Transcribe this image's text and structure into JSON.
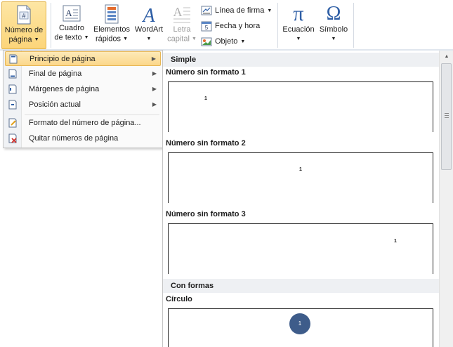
{
  "ribbon": {
    "page_number": {
      "label1": "Número de",
      "label2": "página"
    },
    "text_box": {
      "label1": "Cuadro",
      "label2": "de texto"
    },
    "quick_parts": {
      "label1": "Elementos",
      "label2": "rápidos"
    },
    "wordart": {
      "label": "WordArt"
    },
    "drop_cap": {
      "label1": "Letra",
      "label2": "capital"
    },
    "signature_line": "Línea de firma",
    "date_time": "Fecha y hora",
    "object": "Objeto",
    "equation": "Ecuación",
    "symbol": "Símbolo",
    "pi_glyph": "π",
    "omega_glyph": "Ω"
  },
  "menu": {
    "items": [
      {
        "label": "Principio de página",
        "submenu": true,
        "icon": "page-top-icon"
      },
      {
        "label": "Final de página",
        "submenu": true,
        "icon": "page-bottom-icon"
      },
      {
        "label": "Márgenes de página",
        "submenu": true,
        "icon": "page-margins-icon"
      },
      {
        "label": "Posición actual",
        "submenu": true,
        "icon": "current-position-icon"
      },
      {
        "label": "Formato del número de página...",
        "submenu": false,
        "icon": "format-page-number-icon"
      },
      {
        "label": "Quitar números de página",
        "submenu": false,
        "icon": "remove-page-numbers-icon"
      }
    ]
  },
  "gallery": {
    "sections": [
      {
        "header": "Simple"
      },
      {
        "header": "Con formas"
      }
    ],
    "items": [
      {
        "name": "Número sin formato 1",
        "number": "1"
      },
      {
        "name": "Número sin formato 2",
        "number": "1"
      },
      {
        "name": "Número sin formato 3",
        "number": "1"
      },
      {
        "name": "Círculo",
        "number": "1"
      }
    ]
  },
  "colors": {
    "accent_highlight": "#fcd57a",
    "circle": "#3e5c8a"
  }
}
